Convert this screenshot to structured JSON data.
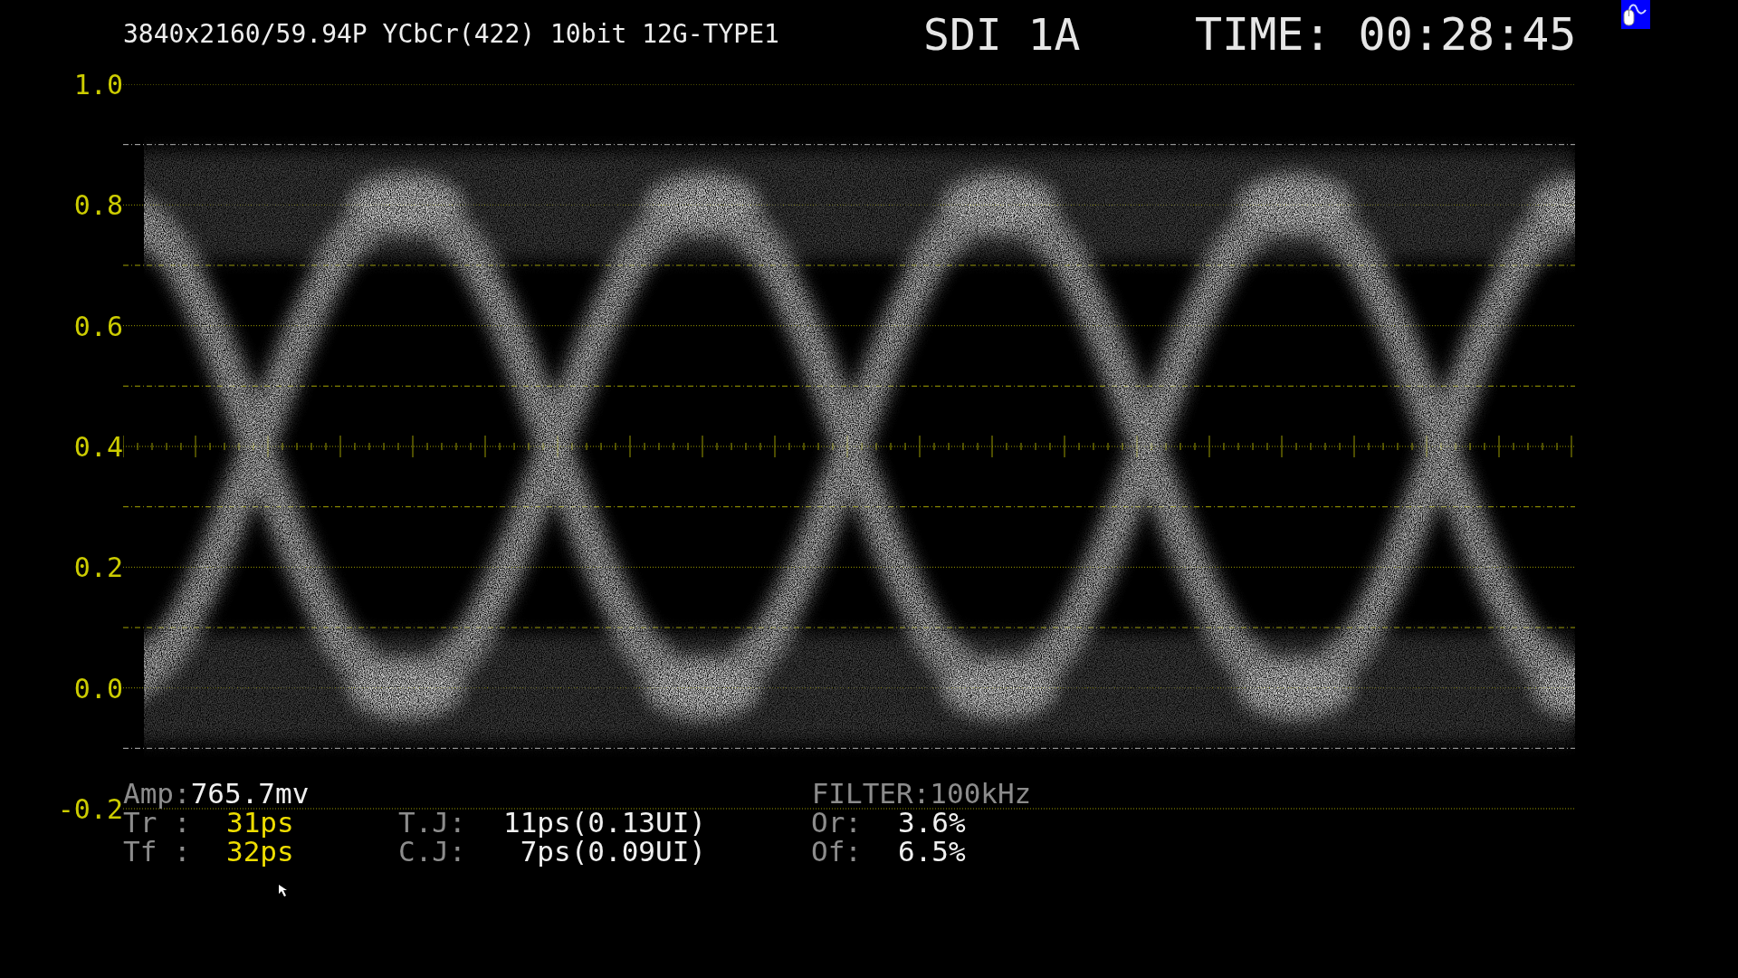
{
  "header": {
    "format": "3840x2160/59.94P YCbCr(422) 10bit 12G-TYPE1",
    "input": "SDI 1A",
    "time": "TIME: 00:28:45"
  },
  "y_axis_labels": [
    "1.0",
    "0.8",
    "0.6",
    "0.4",
    "0.2",
    "0.0",
    "-0.2"
  ],
  "measurements": {
    "amp_label": "Amp:",
    "amp_value": "765.7mv",
    "filter": "FILTER:100kHz",
    "rows": [
      {
        "label": "Tr :",
        "value": "31ps",
        "jitter_label": "T.J:",
        "jitter": "11ps(0.13UI)",
        "ratio_label": "Or:",
        "ratio": "3.6%"
      },
      {
        "label": "Tf :",
        "value": "32ps",
        "jitter_label": "C.J:",
        "jitter": "7ps(0.09UI)",
        "ratio_label": "Of:",
        "ratio": "6.5%"
      }
    ]
  }
}
